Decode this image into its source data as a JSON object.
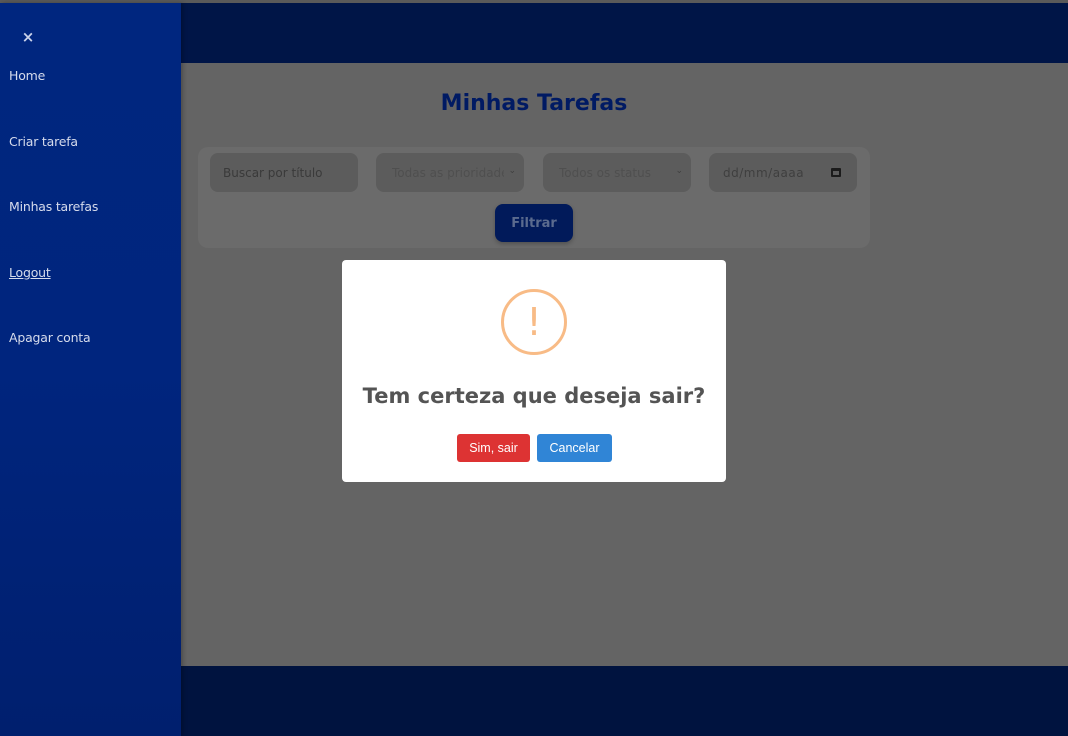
{
  "sidebar": {
    "close_icon": "×",
    "items": [
      {
        "label": "Home"
      },
      {
        "label": "Criar tarefa"
      },
      {
        "label": "Minhas tarefas"
      },
      {
        "label": "Logout"
      },
      {
        "label": "Apagar conta"
      }
    ]
  },
  "main": {
    "title": "Minhas Tarefas",
    "filters": {
      "search_placeholder": "Buscar por título",
      "priority_selected": "Todas as prioridades",
      "status_selected": "Todos os status",
      "date_placeholder": "dd/mm/aaaa",
      "filter_button": "Filtrar"
    }
  },
  "modal": {
    "icon": "warning-icon",
    "icon_glyph": "!",
    "title": "Tem certeza que deseja sair?",
    "confirm_label": "Sim, sair",
    "cancel_label": "Cancelar"
  },
  "colors": {
    "sidebar": "#00267f",
    "header": "#001547",
    "confirm": "#dd3333",
    "cancel": "#3085d6",
    "warning": "#f8bb86"
  }
}
